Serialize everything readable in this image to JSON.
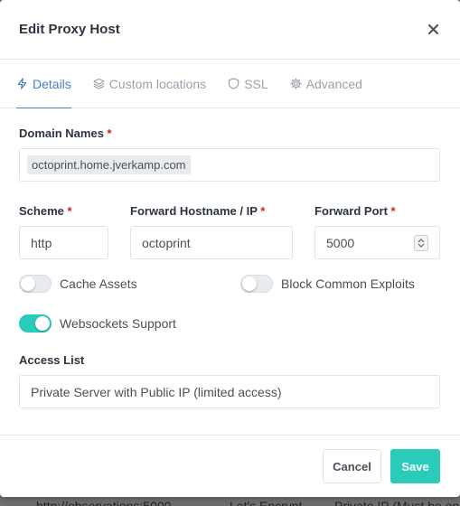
{
  "modal": {
    "title": "Edit Proxy Host"
  },
  "tabs": [
    {
      "label": "Details",
      "icon": "bolt-icon",
      "active": true
    },
    {
      "label": "Custom locations",
      "icon": "layers-icon",
      "active": false
    },
    {
      "label": "SSL",
      "icon": "shield-icon",
      "active": false
    },
    {
      "label": "Advanced",
      "icon": "gear-icon",
      "active": false
    }
  ],
  "form": {
    "domain_names": {
      "label": "Domain Names",
      "required_mark": "*",
      "values": [
        "octoprint.home.jverkamp.com"
      ]
    },
    "scheme": {
      "label": "Scheme",
      "required_mark": "*",
      "value": "http"
    },
    "forward_host": {
      "label": "Forward Hostname / IP",
      "required_mark": "*",
      "value": "octoprint"
    },
    "forward_port": {
      "label": "Forward Port",
      "required_mark": "*",
      "value": "5000"
    },
    "cache_assets": {
      "label": "Cache Assets",
      "enabled": false
    },
    "block_exploits": {
      "label": "Block Common Exploits",
      "enabled": false
    },
    "websockets": {
      "label": "Websockets Support",
      "enabled": true
    },
    "access_list": {
      "label": "Access List",
      "value": "Private Server with Public IP (limited access)"
    }
  },
  "footer": {
    "cancel_label": "Cancel",
    "save_label": "Save"
  },
  "backdrop": {
    "col1": "http://observations:5000",
    "col2": "Let's Encrypt",
    "col3": "Private IP (Must be on"
  },
  "colors": {
    "accent": "#467fcf",
    "toggle_on": "#2bcbba",
    "save_button": "#2bcbba",
    "required": "#cd201f"
  }
}
